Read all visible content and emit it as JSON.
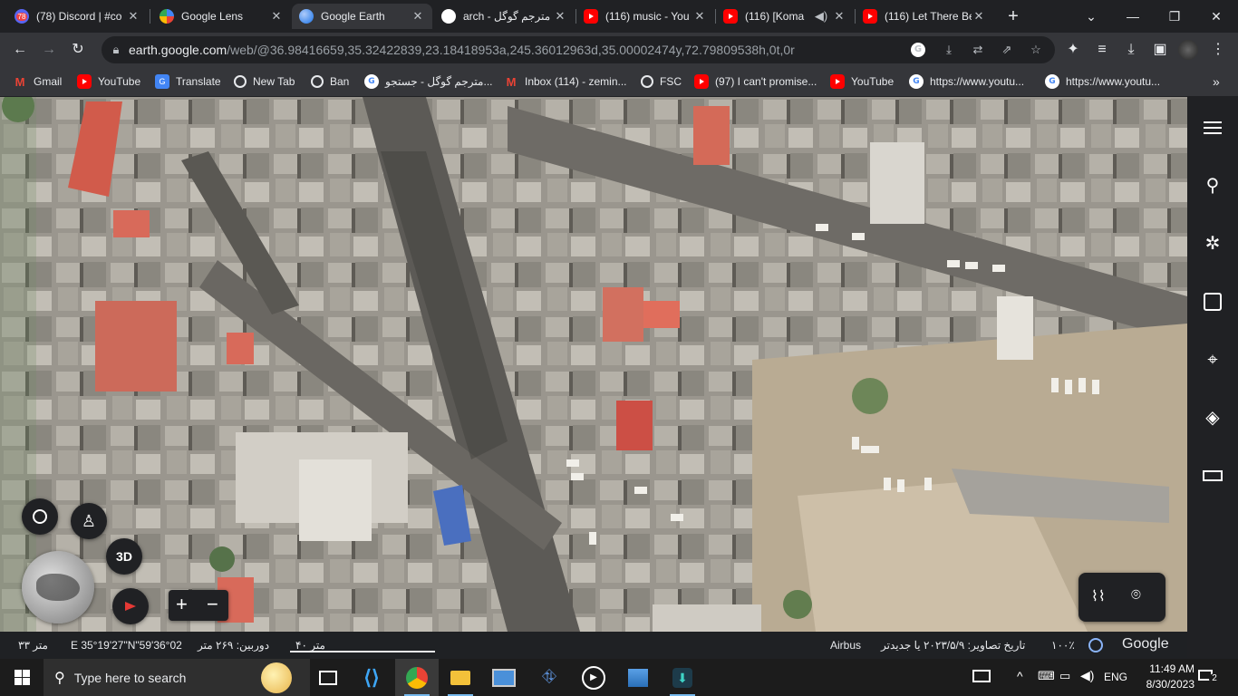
{
  "tabs": [
    {
      "title": "(78) Discord | #co",
      "icon": "discord-icon",
      "active": false
    },
    {
      "title": "Google Lens",
      "icon": "google-lens-icon",
      "active": false
    },
    {
      "title": "Google Earth",
      "icon": "google-earth-icon",
      "active": true
    },
    {
      "title": "arch - مترجم گوگل",
      "icon": "google-icon",
      "active": false
    },
    {
      "title": "(116) music - You",
      "icon": "youtube-icon",
      "active": false
    },
    {
      "title": "(116) [Koma",
      "icon": "youtube-icon",
      "active": false
    },
    {
      "title": "(116) Let There Be",
      "icon": "youtube-icon",
      "active": false
    }
  ],
  "discord_badge": "78",
  "new_tab_label": "+",
  "toolbar": {
    "url_host": "earth.google.com",
    "url_path": "/web/@36.98416659,35.32422839,23.18418953a,245.36012963d,35.00002474y,72.79809538h,0t,0r"
  },
  "bookmarks": [
    {
      "label": "Gmail",
      "icon": "gmail-icon"
    },
    {
      "label": "YouTube",
      "icon": "youtube-icon"
    },
    {
      "label": "Translate",
      "icon": "translate-icon"
    },
    {
      "label": "New Tab",
      "icon": "globe-icon"
    },
    {
      "label": "Ban",
      "icon": "globe-icon"
    },
    {
      "label": "مترجم گوگل - جستجو...",
      "icon": "google-icon"
    },
    {
      "label": "Inbox (114) - zemin...",
      "icon": "gmail-icon"
    },
    {
      "label": "FSC",
      "icon": "globe-icon"
    },
    {
      "label": "(97) I can't promise...",
      "icon": "youtube-icon"
    },
    {
      "label": "YouTube",
      "icon": "youtube-icon"
    },
    {
      "label": "https://www.youtu...",
      "icon": "google-icon"
    },
    {
      "label": "https://www.youtu...",
      "icon": "google-icon"
    }
  ],
  "map_controls": {
    "three_d_label": "3D",
    "zoom_in": "+",
    "zoom_out": "−"
  },
  "status": {
    "elevation": "۳۳ متر",
    "coords": "36°02'59\"E 35°19'27\"N",
    "camera": "دوربین: ۲۶۹ متر",
    "scale": "۴۰ متر",
    "attribution": "Airbus",
    "imagery_date": "تاریخ تصاویر: ۲۰۲۳/۵/۹ یا جدیدتر",
    "loaded": "۱۰۰٪",
    "brand": "Google"
  },
  "taskbar": {
    "search_placeholder": "Type here to search",
    "language": "ENG",
    "time": "11:49 AM",
    "date": "8/30/2023",
    "notification_count": "2"
  },
  "colors": {
    "tab_bg": "#202124",
    "active_tab": "#35363a",
    "youtube_red": "#ff0000",
    "map_panel": "#202124"
  }
}
